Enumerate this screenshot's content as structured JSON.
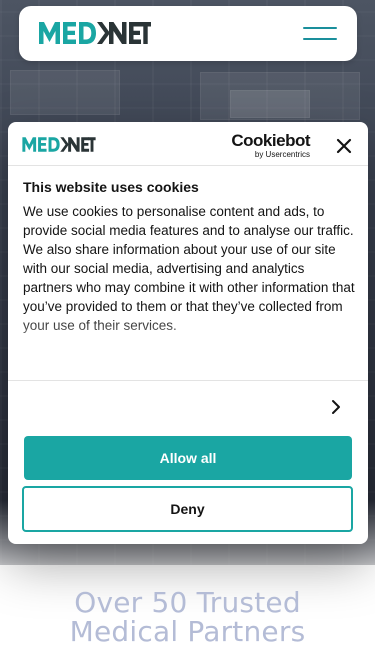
{
  "brand": {
    "logo_text": "MEDNET",
    "accent_color": "#1aa6a3",
    "dark_color": "#2a3436"
  },
  "nav": {
    "menu_icon": "hamburger-menu-icon"
  },
  "cookie_dialog": {
    "provider_name": "Cookiebot",
    "provider_sub": "by Usercentrics",
    "close_icon": "close-icon",
    "title": "This website uses cookies",
    "body": "We use cookies to personalise content and ads, to provide social media features and to analyse our traffic. We also share information about your use of our site with our social media, advertising and analytics partners who may combine it with other information that you’ve provided to them or that they’ve collected from your use of their services.",
    "details_icon": "chevron-right-icon",
    "allow_all_label": "Allow all",
    "deny_label": "Deny"
  },
  "page": {
    "headline_line1": "Over 50 Trusted",
    "headline_line2": "Medical Partners"
  }
}
